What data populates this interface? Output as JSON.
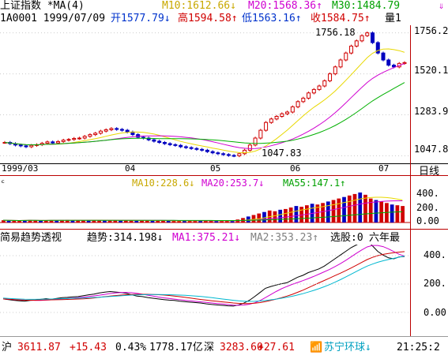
{
  "header": {
    "title": "上证指数 *MA(4)",
    "ma10": "M10:1612.66↓",
    "ma20": "M20:1568.36↑",
    "ma30": "M30:1484.79",
    "code_date": "1A0001 1999/07/09",
    "open": "开1577.79↓",
    "high": "高1594.58↑",
    "low": "低1563.16↑",
    "close": "收1584.75↑",
    "vol_label": "量1"
  },
  "price_axis": [
    "1756.2",
    "1520.1",
    "1283.9",
    "1047.8"
  ],
  "annotations": {
    "high": "1756.18",
    "low": "1047.83"
  },
  "time_axis": [
    "1999/03",
    "04",
    "05",
    "06",
    "07"
  ],
  "period_label": "日线",
  "volume": {
    "prefix": "ᶜ",
    "ma10": "MA10:228.6↓",
    "ma20": "MA20:253.7↓",
    "ma55": "MA55:147.1↑",
    "axis": [
      "400.",
      "200.",
      "0.00"
    ]
  },
  "trend": {
    "title": "简易趋势透视",
    "trend": "趋势:314.198↓",
    "ma1": "MA1:375.21↓",
    "ma2": "MA2:353.23↑",
    "pick": "选股:0",
    "best": "六年最",
    "axis": [
      "400.",
      "200.",
      "0.00"
    ]
  },
  "status": {
    "sh_label": "沪",
    "sh_index": "3611.87",
    "sh_change": "+15.43",
    "sh_pct": "0.43%",
    "sh_amount": "1778.17亿",
    "sz_label": "深",
    "sz_index": "3283.60",
    "sz_change": "+27.61",
    "stock": "苏宁环球↓",
    "time": "21:25:2"
  },
  "chart_data": [
    {
      "type": "candlestick",
      "title": "上证指数",
      "x": [
        "1999/03",
        "04",
        "05",
        "06",
        "07"
      ],
      "ylim": [
        1047.83,
        1756.18
      ],
      "yticks": [
        1756.2,
        1520.1,
        1283.9,
        1047.8
      ],
      "series": [
        {
          "name": "M10",
          "last": 1612.66
        },
        {
          "name": "M20",
          "last": 1568.36
        },
        {
          "name": "M30",
          "last": 1484.79
        }
      ],
      "close": [
        1125,
        1118,
        1110,
        1105,
        1100,
        1108,
        1112,
        1120,
        1128,
        1122,
        1130,
        1138,
        1142,
        1148,
        1150,
        1160,
        1170,
        1178,
        1190,
        1198,
        1205,
        1200,
        1195,
        1185,
        1170,
        1155,
        1150,
        1140,
        1132,
        1125,
        1118,
        1112,
        1108,
        1100,
        1095,
        1090,
        1085,
        1080,
        1072,
        1065,
        1060,
        1055,
        1050,
        1048,
        1060,
        1080,
        1110,
        1150,
        1195,
        1240,
        1260,
        1275,
        1290,
        1300,
        1330,
        1360,
        1380,
        1410,
        1430,
        1450,
        1480,
        1520,
        1560,
        1600,
        1640,
        1680,
        1710,
        1740,
        1756,
        1700,
        1640,
        1600,
        1570,
        1560,
        1580,
        1584.75
      ]
    },
    {
      "type": "bar",
      "title": "成交量",
      "series": [
        {
          "name": "MA10",
          "last": 228.6
        },
        {
          "name": "MA20",
          "last": 253.7
        },
        {
          "name": "MA55",
          "last": 147.1
        }
      ],
      "values": [
        30,
        28,
        25,
        22,
        30,
        35,
        26,
        24,
        28,
        32,
        30,
        34,
        36,
        30,
        28,
        32,
        34,
        30,
        26,
        28,
        30,
        32,
        28,
        26,
        24,
        22,
        26,
        28,
        24,
        22,
        26,
        24,
        22,
        20,
        24,
        22,
        20,
        24,
        26,
        22,
        20,
        18,
        22,
        25,
        40,
        60,
        80,
        100,
        120,
        140,
        160,
        150,
        170,
        180,
        200,
        220,
        210,
        230,
        250,
        240,
        260,
        280,
        300,
        320,
        340,
        360,
        380,
        400,
        370,
        320,
        300,
        280,
        260,
        240,
        230,
        220
      ],
      "ylim": [
        0,
        400
      ]
    },
    {
      "type": "line",
      "title": "简易趋势透视",
      "series": [
        {
          "name": "趋势",
          "last": 314.198
        },
        {
          "name": "MA1",
          "last": 375.21
        },
        {
          "name": "MA2",
          "last": 353.23
        }
      ],
      "ylim": [
        0,
        400
      ]
    }
  ]
}
